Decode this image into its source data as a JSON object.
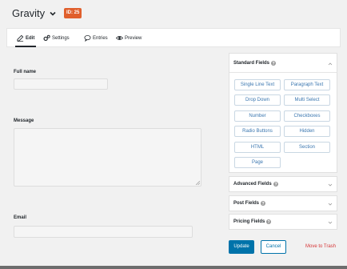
{
  "header": {
    "form_title": "Gravity",
    "id_badge": "ID: 25"
  },
  "tabs": [
    {
      "label": "Edit",
      "icon": "edit-icon",
      "active": true
    },
    {
      "label": "Settings",
      "icon": "gears-icon"
    },
    {
      "label": "Entries",
      "icon": "comment-icon"
    },
    {
      "label": "Preview",
      "icon": "eye-icon"
    }
  ],
  "form_fields": [
    {
      "label": "Full name",
      "type": "text"
    },
    {
      "label": "Message",
      "type": "textarea"
    },
    {
      "label": "Email",
      "type": "text"
    }
  ],
  "sidebar": {
    "standard": {
      "title": "Standard Fields",
      "buttons": [
        "Single Line Text",
        "Paragraph Text",
        "Drop Down",
        "Multi Select",
        "Number",
        "Checkboxes",
        "Radio Buttons",
        "Hidden",
        "HTML",
        "Section",
        "Page"
      ]
    },
    "advanced": {
      "title": "Advanced Fields"
    },
    "post": {
      "title": "Post Fields"
    },
    "pricing": {
      "title": "Pricing Fields"
    }
  },
  "actions": {
    "update": "Update",
    "cancel": "Cancel",
    "trash": "Move to Trash"
  },
  "colors": {
    "badge": "#e05f2c",
    "primary": "#0073aa",
    "danger": "#d63638",
    "field_button_text": "#3b77b0"
  }
}
